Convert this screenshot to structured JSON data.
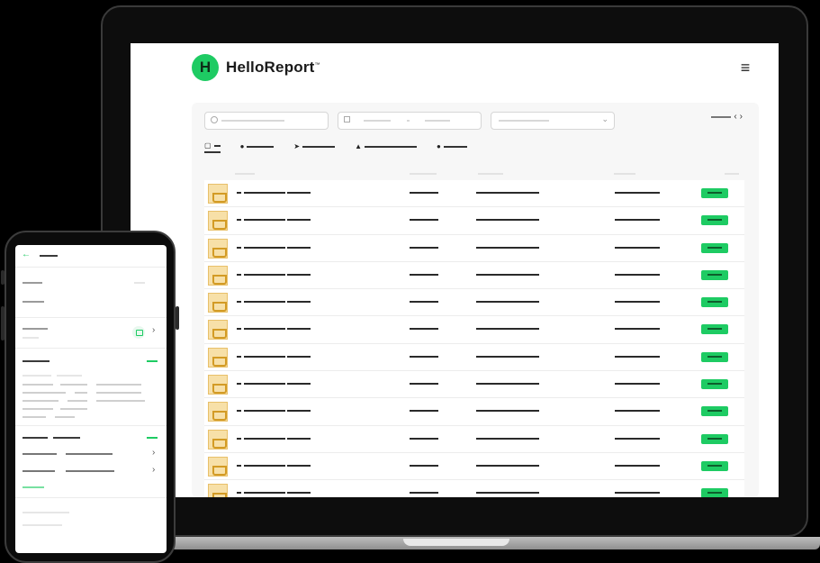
{
  "app": {
    "logo_mark": "H",
    "name": "HelloReport",
    "trademark": "™"
  },
  "header": {
    "menu_icon": "hamburger-menu-icon",
    "menu_glyph": "≡"
  },
  "pager": {
    "prev_glyph": "‹",
    "next_glyph": "›"
  },
  "tabs": [
    {
      "icon": "document-icon",
      "glyph": "▢",
      "active": true
    },
    {
      "icon": "circle-icon",
      "glyph": "●",
      "active": false
    },
    {
      "icon": "location-icon",
      "glyph": "➤",
      "active": false
    },
    {
      "icon": "user-icon",
      "glyph": "▲",
      "active": false
    },
    {
      "icon": "circle-icon",
      "glyph": "●",
      "active": false
    }
  ],
  "table": {
    "row_count": 12,
    "status_color": "#1ecb63"
  },
  "brand": {
    "accent": "#1ecb63",
    "thumb_color": "#f7e0a8"
  },
  "phone": {
    "back_glyph": "←",
    "chevron_glyph": "›"
  }
}
